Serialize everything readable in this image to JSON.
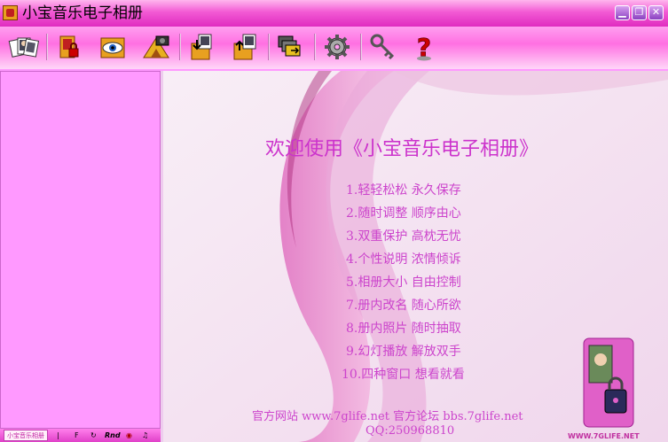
{
  "window": {
    "title": "小宝音乐电子相册",
    "controls": [
      "minimize",
      "maximize",
      "close"
    ]
  },
  "toolbar": {
    "buttons": [
      {
        "name": "album-photos-icon"
      },
      {
        "name": "open-album-lock-icon"
      },
      {
        "name": "view-eye-icon"
      },
      {
        "name": "camera-triangle-icon"
      },
      {
        "name": "import-photos-icon"
      },
      {
        "name": "export-photos-icon"
      },
      {
        "name": "window-layers-icon"
      },
      {
        "name": "settings-gear-icon"
      },
      {
        "name": "key-icon"
      },
      {
        "name": "help-question-icon"
      }
    ]
  },
  "statusbar": {
    "logo_text": "小宝音乐相册",
    "items": [
      "F",
      "Rnd"
    ]
  },
  "content": {
    "welcome": "欢迎使用《小宝音乐电子相册》",
    "features": [
      "1.轻轻松松 永久保存",
      "2.随时调整 顺序由心",
      "3.双重保护 高枕无忧",
      "4.个性说明 浓情倾诉",
      "5.相册大小 自由控制",
      "7.册内改名 随心所欲",
      "8.册内照片 随时抽取",
      "9.幻灯播放 解放双手",
      "10.四种窗口 想看就看"
    ],
    "footer_line1": "官方网站 www.7glife.net 官方论坛 bbs.7glife.net",
    "footer_line2": "QQ:250968810",
    "watermark": "WWW.7GLIFE.NET"
  },
  "colors": {
    "title_pink": "#e02cc0",
    "panel_pink": "#ff99ff",
    "text_magenta": "#cc44cc"
  }
}
